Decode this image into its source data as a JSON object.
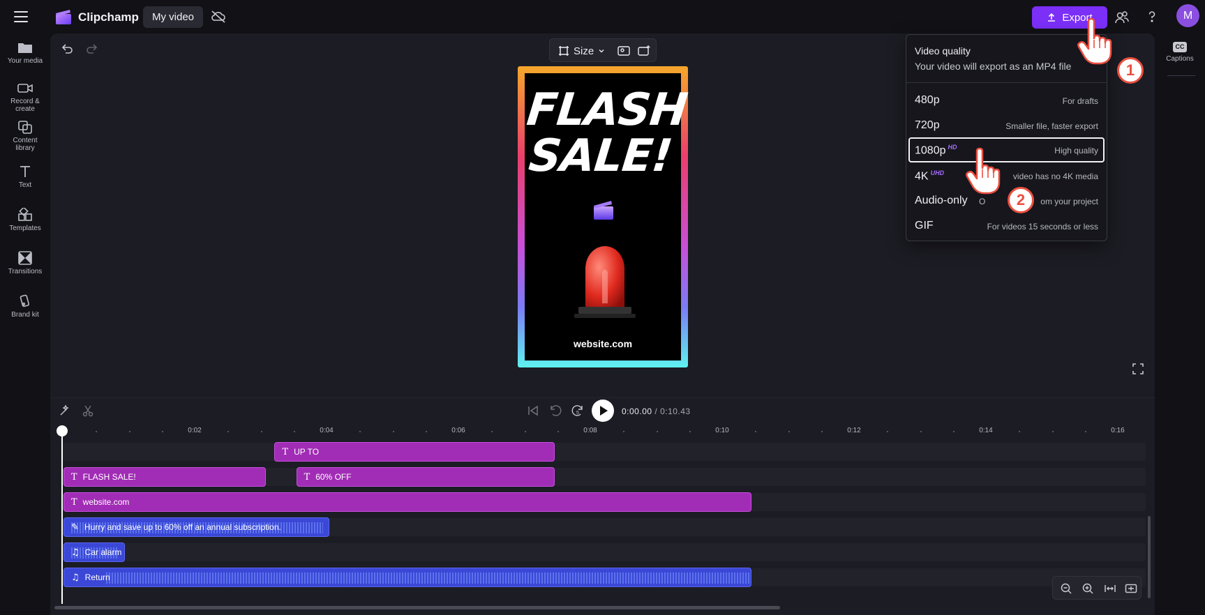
{
  "app": {
    "title": "Clipchamp",
    "project_name": "My video",
    "export_label": "Export",
    "avatar_initial": "M"
  },
  "sidebar": {
    "items": [
      {
        "label": "Your media",
        "icon": "folder-icon"
      },
      {
        "label": "Record & create",
        "icon": "camera-icon"
      },
      {
        "label": "Content library",
        "icon": "library-icon"
      },
      {
        "label": "Text",
        "icon": "text-icon"
      },
      {
        "label": "Templates",
        "icon": "templates-icon"
      },
      {
        "label": "Transitions",
        "icon": "transitions-icon"
      },
      {
        "label": "Brand kit",
        "icon": "brand-kit-icon"
      }
    ]
  },
  "right_rail": {
    "captions_label": "Captions",
    "cc_text": "CC"
  },
  "canvas_toolbar": {
    "size_label": "Size"
  },
  "preview": {
    "headline": "FLASH SALE!",
    "footer": "website.com"
  },
  "export_menu": {
    "title": "Video quality",
    "subtitle": "Your video will export as an MP4 file",
    "options": [
      {
        "label": "480p",
        "badge": "",
        "desc": "For drafts",
        "selected": false
      },
      {
        "label": "720p",
        "badge": "",
        "desc": "Smaller file, faster export",
        "selected": false
      },
      {
        "label": "1080p",
        "badge": "HD",
        "desc": "High quality",
        "selected": true
      },
      {
        "label": "4K",
        "badge": "UHD",
        "desc": "video has no 4K media",
        "selected": false
      },
      {
        "label": "Audio-only",
        "badge": "",
        "desc": "om your project",
        "selected": false
      },
      {
        "label": "GIF",
        "badge": "",
        "desc": "For videos 15 seconds or less",
        "selected": false
      }
    ],
    "audio_only_prefix": "O"
  },
  "steps": {
    "step1": "1",
    "step2": "2"
  },
  "playback": {
    "current": "0:00.00",
    "separator": " / ",
    "total": "0:10.43"
  },
  "ruler": {
    "labels": [
      "0:02",
      "0:04",
      "0:06",
      "0:08",
      "0:10",
      "0:12",
      "0:14",
      "0:16"
    ]
  },
  "timeline": {
    "clips": [
      {
        "kind": "text",
        "label": "UP TO",
        "track": 0,
        "start_s": 3.2,
        "end_s": 7.45
      },
      {
        "kind": "text",
        "label": "FLASH SALE!",
        "track": 1,
        "start_s": 0.0,
        "end_s": 3.07
      },
      {
        "kind": "text",
        "label": "60% OFF",
        "track": 1,
        "start_s": 3.53,
        "end_s": 7.45
      },
      {
        "kind": "text",
        "label": "website.com",
        "track": 2,
        "start_s": 0.0,
        "end_s": 10.43
      },
      {
        "kind": "voice",
        "label": "Hurry and save up to 60% off an annual subscription.",
        "track": 3,
        "start_s": 0.0,
        "end_s": 4.03
      },
      {
        "kind": "music",
        "label": "Car alarm",
        "track": 4,
        "start_s": 0.0,
        "end_s": 0.93
      },
      {
        "kind": "music",
        "label": "Return",
        "track": 5,
        "start_s": 0.0,
        "end_s": 10.43
      }
    ]
  },
  "colors": {
    "accent": "#7b2ff7",
    "text_clip": "#a12cb5",
    "audio_clip": "#3b47d6",
    "step_badge": "#ea4f3f"
  }
}
